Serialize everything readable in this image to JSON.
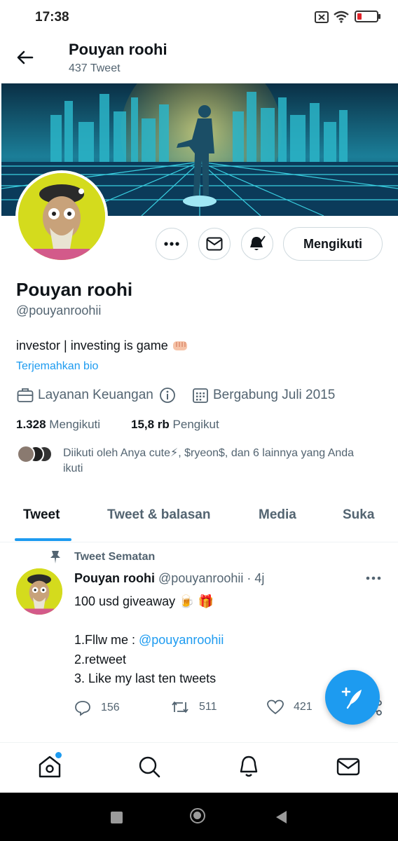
{
  "status_bar": {
    "time": "17:38",
    "battery_color": "#e0242b"
  },
  "header": {
    "name": "Pouyan roohi",
    "tweet_count": "437 Tweet"
  },
  "profile": {
    "name": "Pouyan roohi",
    "handle": "@pouyanroohii",
    "bio": "investor | investing is game ",
    "translate_link": "Terjemahkan bio",
    "category": "Layanan Keuangan",
    "joined": "Bergabung Juli 2015",
    "following_count": "1.328",
    "following_label": "Mengikuti",
    "followers_count": "15,8 rb",
    "followers_label": "Pengikut",
    "followed_by": "Diikuti oleh Anya cute⚡, $ryeon$, dan 6 lainnya yang Anda ikuti",
    "follow_button": "Mengikuti"
  },
  "tabs": [
    {
      "label": "Tweet",
      "active": true
    },
    {
      "label": "Tweet & balasan",
      "active": false
    },
    {
      "label": "Media",
      "active": false
    },
    {
      "label": "Suka",
      "active": false
    }
  ],
  "tweet": {
    "pinned_label": "Tweet Sematan",
    "name": "Pouyan roohi",
    "handle_time": "@pouyanroohii · 4j",
    "line1": "100 usd giveaway 🍺 🎁",
    "line2": "",
    "line3_prefix": "1.Fllw me : ",
    "line3_mention": "@pouyanroohii",
    "line4": "2.retweet",
    "line5": "3. Like my last ten tweets",
    "replies": "156",
    "retweets": "511",
    "likes": "421"
  },
  "colors": {
    "accent": "#1d9bf0",
    "text": "#0f1419",
    "muted": "#536471"
  },
  "icons": [
    "back-arrow-icon",
    "more-icon",
    "mail-icon",
    "bell-icon",
    "briefcase-icon",
    "info-icon",
    "calendar-icon",
    "pin-icon",
    "reply-icon",
    "retweet-icon",
    "like-icon",
    "share-icon",
    "compose-icon",
    "home-icon",
    "search-icon",
    "notifications-icon",
    "messages-icon"
  ]
}
